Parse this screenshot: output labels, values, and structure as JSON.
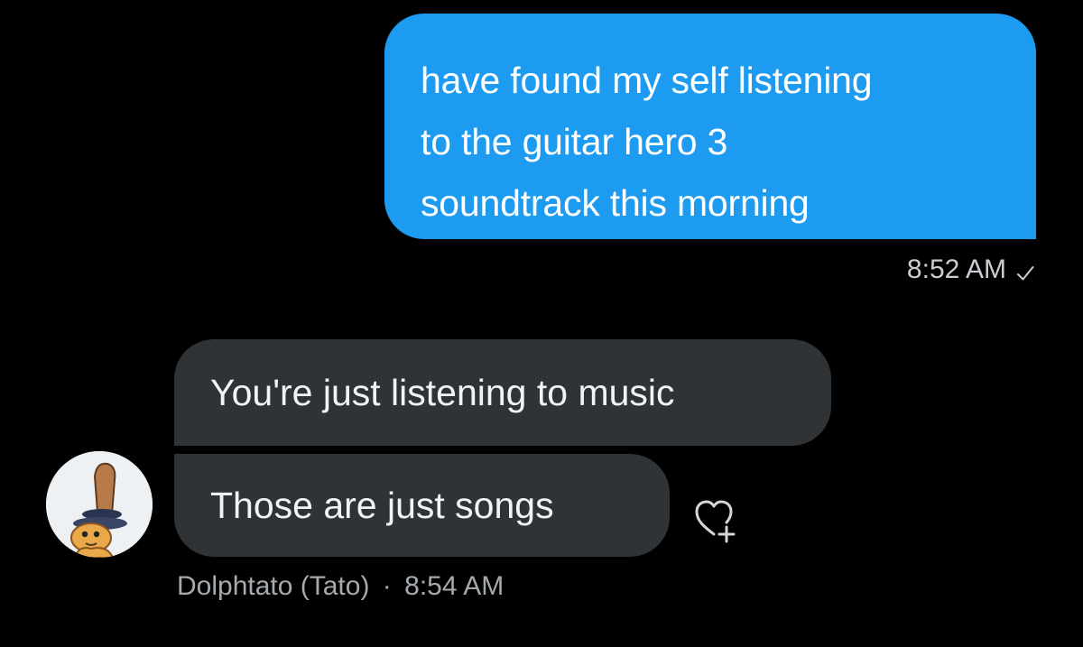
{
  "conversation": {
    "sent_message": {
      "lines": [
        "have found my self listening",
        "to the guitar hero 3",
        "soundtrack this morning"
      ],
      "time": "8:52 AM",
      "status_icon": "check-icon",
      "color": "#1d9bf0"
    },
    "received_messages": [
      {
        "text": "You're just listening to music"
      },
      {
        "text": "Those are just songs"
      }
    ],
    "received_meta": {
      "sender": "Dolphtato (Tato)",
      "separator": "·",
      "time": "8:54 AM"
    },
    "reaction_button_icon": "add-reaction-heart-icon",
    "avatar_icon": "cartoon-avatar"
  },
  "colors": {
    "background": "#000000",
    "received_bubble": "#2f3336",
    "meta_text": "#a5aaaf"
  }
}
